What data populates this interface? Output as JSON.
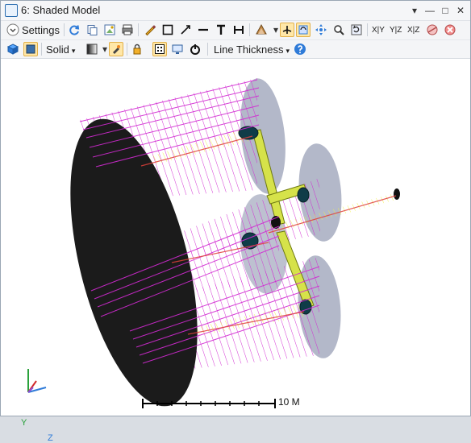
{
  "window": {
    "title": "6: Shaded Model"
  },
  "toolbar": {
    "settings_label": "Settings",
    "render_mode": "Solid",
    "line_thickness_label": "Line Thickness",
    "axis_buttons": [
      "X|Y",
      "Y|Z",
      "X|Z"
    ]
  },
  "scale_bar": {
    "label": "10 M"
  },
  "axes": {
    "y": "Y",
    "z": "Z"
  },
  "colors": {
    "rays_primary": "#d22ad2",
    "rays_secondary": "#f0f04a",
    "surface_dark": "#1b1b1b",
    "surface_light": "#9aa0b7",
    "accent_blue": "#2f7bd8"
  }
}
